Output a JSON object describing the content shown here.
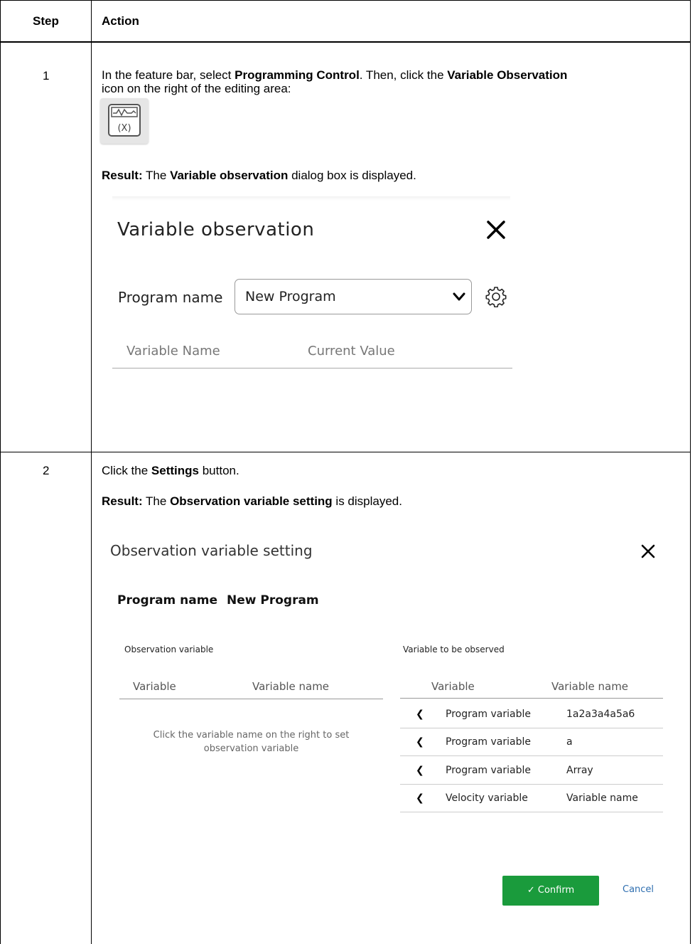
{
  "table": {
    "header_step": "Step",
    "header_action": "Action"
  },
  "step1": {
    "number": "1",
    "instr_pre": "In the feature bar, select ",
    "instr_b1": "Programming Control",
    "instr_mid": ". Then, click the ",
    "instr_b2": "Variable Observation",
    "instr_post": "icon on the right of the editing area:",
    "result_label": "Result:",
    "result_pre": " The ",
    "result_bold": "Variable observation",
    "result_post": " dialog box is displayed.",
    "icon_glyph_text": "(X)",
    "dialog": {
      "title": "Variable observation",
      "program_label": "Program name",
      "program_value": "New Program",
      "col_variable_name": "Variable Name",
      "col_current_value": "Current Value"
    }
  },
  "step2": {
    "number": "2",
    "instr_pre": "Click the ",
    "instr_bold": "Settings",
    "instr_post": " button.",
    "result_label": "Result:",
    "result_pre": " The ",
    "result_bold": "Observation variable setting",
    "result_post": " is displayed.",
    "dialog": {
      "title": "Observation variable setting",
      "program_label": "Program name",
      "program_value": "New Program",
      "observation_title": "Observation variable",
      "to_be_observed_title": "Variable to be observed",
      "left_col_variable": "Variable",
      "left_col_name": "Variable name",
      "hint_line1": "Click the variable name on the right to set",
      "hint_line2": "observation variable",
      "right_col_variable": "Variable",
      "right_col_name": "Variable name",
      "rows": [
        {
          "type": "Program variable",
          "name": "1a2a3a4a5a6"
        },
        {
          "type": "Program variable",
          "name": "a"
        },
        {
          "type": "Program variable",
          "name": "Array"
        },
        {
          "type": "Velocity variable",
          "name": "Variable name"
        }
      ],
      "confirm_label": "✓ Confirm",
      "cancel_label": "Cancel"
    }
  }
}
